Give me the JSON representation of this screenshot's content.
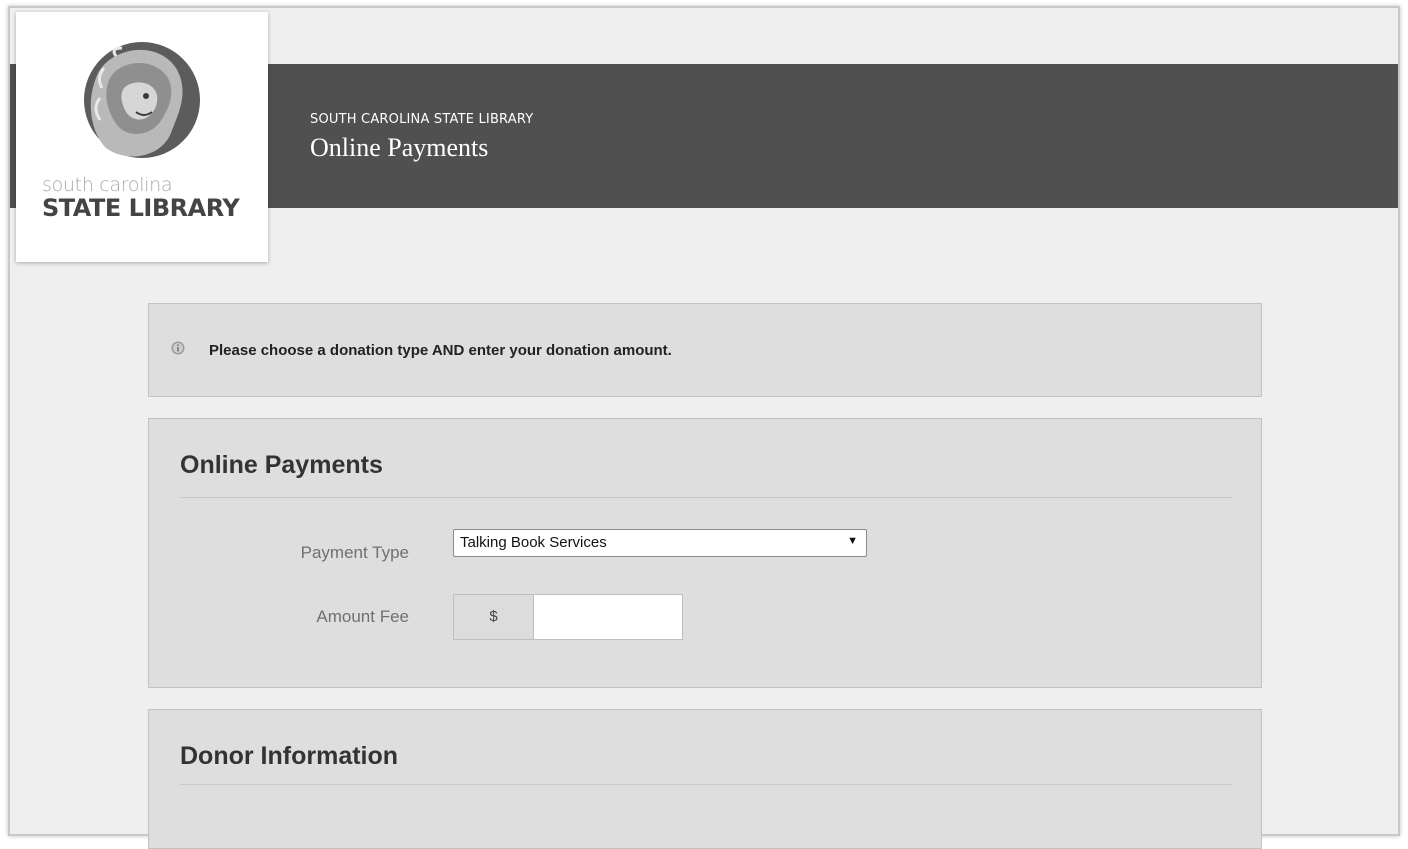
{
  "header": {
    "org_name": "SOUTH CAROLINA STATE LIBRARY",
    "page_title": "Online Payments"
  },
  "logo": {
    "line1": "south carolina",
    "line2": "STATE LIBRARY"
  },
  "notice": {
    "icon": "info-icon",
    "text": "Please choose a donation type AND enter your donation amount."
  },
  "payments_section": {
    "title": "Online Payments",
    "payment_type_label": "Payment Type",
    "payment_type_selected": "Talking Book Services",
    "amount_label": "Amount Fee",
    "currency_symbol": "$",
    "amount_value": ""
  },
  "donor_section": {
    "title": "Donor Information"
  },
  "colors": {
    "header_bar": "#505050",
    "page_background": "#efefef",
    "panel_background": "#dedede"
  }
}
